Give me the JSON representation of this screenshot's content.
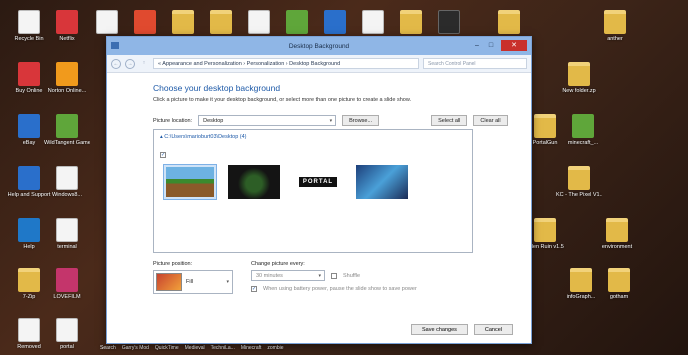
{
  "desktop": {
    "left_icons": [
      {
        "label": "Recycle Bin",
        "icon": "recycle-bin-icon"
      },
      {
        "label": "Netflix",
        "icon": "netflix-icon"
      },
      {
        "label": "Buy Online",
        "icon": "buy-online-icon"
      },
      {
        "label": "Norton Online...",
        "icon": "norton-icon"
      },
      {
        "label": "eBay",
        "icon": "ebay-icon"
      },
      {
        "label": "WildTangent Games",
        "icon": "wildtangent-icon"
      },
      {
        "label": "Help and Support",
        "icon": "help-support-icon"
      },
      {
        "label": "Windows8...",
        "icon": "document-icon"
      },
      {
        "label": "Help",
        "icon": "help-icon"
      },
      {
        "label": "terminal",
        "icon": "document-icon"
      },
      {
        "label": "7-Zip",
        "icon": "folder-icon"
      },
      {
        "label": "LOVEFILM",
        "icon": "lovefilm-icon"
      },
      {
        "label": "Removed",
        "icon": "document-icon"
      },
      {
        "label": "portal",
        "icon": "document-icon"
      }
    ],
    "right_icons": [
      {
        "label": "anther",
        "icon": "folder-icon"
      },
      {
        "label": "New folder.zp",
        "icon": "folder-icon"
      },
      {
        "label": "PortalGun",
        "icon": "folder-icon"
      },
      {
        "label": "minecraft_...",
        "icon": "minecraft-icon"
      },
      {
        "label": "KC - The Pixel V1...",
        "icon": "folder-icon"
      },
      {
        "label": "Eden Ruin v1.5",
        "icon": "folder-icon"
      },
      {
        "label": "environment",
        "icon": "folder-icon"
      },
      {
        "label": "infoGraph...",
        "icon": "folder-icon"
      },
      {
        "label": "gotham",
        "icon": "folder-icon"
      }
    ],
    "bottom_labels": [
      "Search",
      "Garry's Mod",
      "QuickTime",
      "Medieval",
      "TechniLa...",
      "Minecraft",
      "zombie"
    ]
  },
  "window": {
    "title": "Desktop Background",
    "buttons": {
      "minimize": "–",
      "maximize": "□",
      "close": "✕"
    },
    "nav": {
      "back": "←",
      "forward": "→",
      "up": "↑"
    },
    "breadcrumb": "« Appearance and Personalization › Personalization › Desktop Background",
    "search_placeholder": "Search Control Panel",
    "heading": "Choose your desktop background",
    "subtext": "Click a picture to make it your desktop background, or select more than one picture to create a slide show.",
    "picture_location_label": "Picture location:",
    "picture_location_value": "Desktop",
    "browse_label": "Browse...",
    "select_all_label": "Select all",
    "clear_all_label": "Clear all",
    "folder_path": "▴ C:\\Users\\marioburt03\\Desktop (4)",
    "thumbnails": [
      {
        "name": "minecraft-wallpaper",
        "selected": true
      },
      {
        "name": "dark-creeper-wallpaper",
        "selected": false
      },
      {
        "name": "portal-wallpaper",
        "text": "PORTAL",
        "selected": false
      },
      {
        "name": "batman-wallpaper",
        "selected": false
      }
    ],
    "picture_position_label": "Picture position:",
    "picture_position_value": "Fill",
    "change_every_label": "Change picture every:",
    "change_every_value": "30 minutes",
    "shuffle_label": "Shuffle",
    "battery_label": "When using battery power, pause the slide show to save power",
    "save_label": "Save changes",
    "cancel_label": "Cancel"
  }
}
